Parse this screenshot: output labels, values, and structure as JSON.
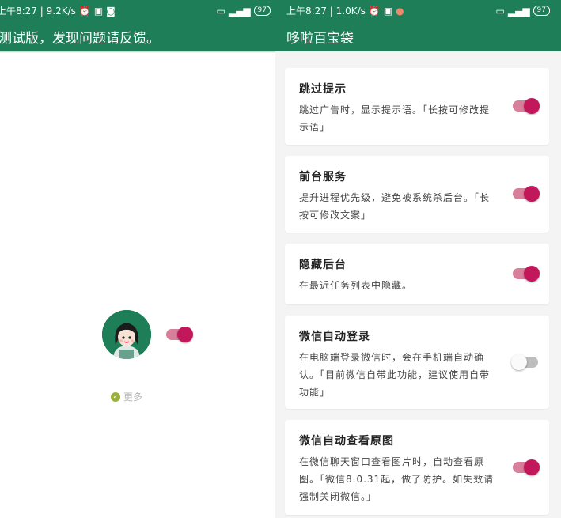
{
  "left": {
    "status": {
      "time_info": "上午8:27 | 9.2K/s",
      "battery": "97"
    },
    "title": "测试版，发现问题请反馈。",
    "avatar_icon": "girl-avatar-icon",
    "toggle_on": true,
    "more_label": "更多"
  },
  "right": {
    "status": {
      "time_info": "上午8:27 | 1.0K/s",
      "battery": "97"
    },
    "title": "哆啦百宝袋",
    "cards": [
      {
        "title": "跳过提示",
        "desc": "跳过广告时，显示提示语。「长按可修改提示语」",
        "on": true
      },
      {
        "title": "前台服务",
        "desc": "提升进程优先级，避免被系统杀后台。「长按可修改文案」",
        "on": true
      },
      {
        "title": "隐藏后台",
        "desc": "在最近任务列表中隐藏。",
        "on": true
      },
      {
        "title": "微信自动登录",
        "desc": "在电脑端登录微信时，会在手机端自动确认。「目前微信自带此功能，建议使用自带功能」",
        "on": false
      },
      {
        "title": "微信自动查看原图",
        "desc": "在微信聊天窗口查看图片时，自动查看原图。「微信8.0.31起，做了防护。如失效请强制关闭微信。」",
        "on": true
      }
    ]
  },
  "colors": {
    "primary": "#1d7e58",
    "accent": "#c2185b",
    "accent_track": "#d87f9b"
  }
}
